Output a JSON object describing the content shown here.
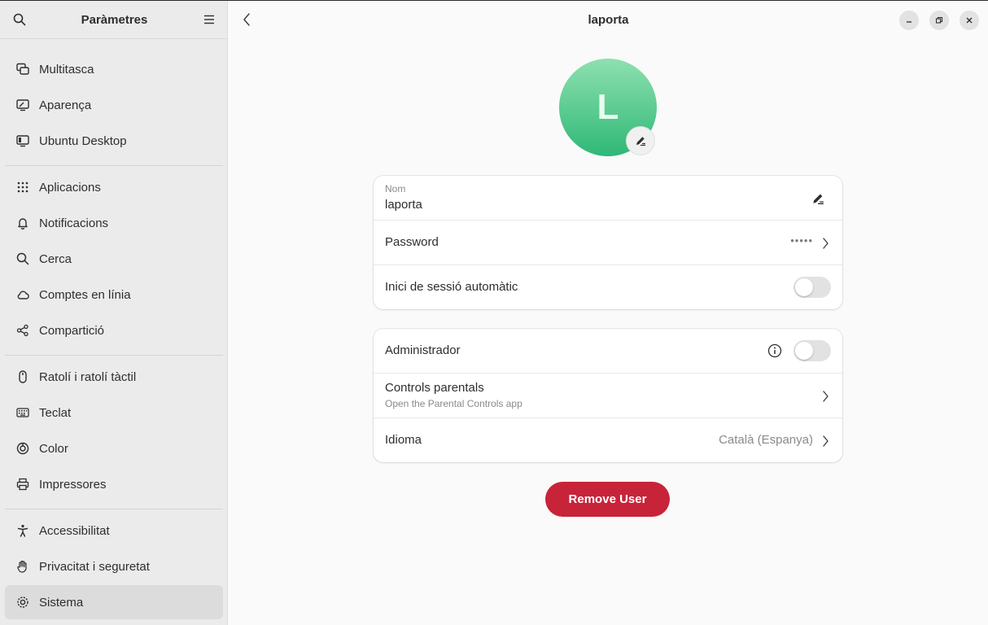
{
  "sidebar": {
    "title": "Paràmetres",
    "items": [
      {
        "label": "Multitasca",
        "icon": "multitasking-icon"
      },
      {
        "label": "Aparença",
        "icon": "appearance-icon"
      },
      {
        "label": "Ubuntu Desktop",
        "icon": "ubuntu-desktop-icon"
      },
      {
        "label": "Aplicacions",
        "icon": "apps-grid-icon"
      },
      {
        "label": "Notificacions",
        "icon": "bell-icon"
      },
      {
        "label": "Cerca",
        "icon": "search-icon"
      },
      {
        "label": "Comptes en línia",
        "icon": "cloud-icon"
      },
      {
        "label": "Compartició",
        "icon": "share-icon"
      },
      {
        "label": "Ratolí i ratolí tàctil",
        "icon": "mouse-icon"
      },
      {
        "label": "Teclat",
        "icon": "keyboard-icon"
      },
      {
        "label": "Color",
        "icon": "color-icon"
      },
      {
        "label": "Impressores",
        "icon": "printer-icon"
      },
      {
        "label": "Accessibilitat",
        "icon": "accessibility-icon"
      },
      {
        "label": "Privacitat i seguretat",
        "icon": "hand-icon"
      },
      {
        "label": "Sistema",
        "icon": "gear-icon",
        "active": true
      }
    ]
  },
  "header": {
    "title": "laporta"
  },
  "avatar": {
    "initial": "L",
    "colors": [
      "#8ee0af",
      "#2fb877"
    ]
  },
  "account": {
    "name_label": "Nom",
    "name_value": "laporta",
    "password_label": "Password",
    "password_value": "•••••",
    "autologin_label": "Inici de sessió automàtic",
    "autologin_on": false
  },
  "settings": {
    "admin_label": "Administrador",
    "admin_on": false,
    "parental_label": "Controls parentals",
    "parental_sub": "Open the Parental Controls app",
    "language_label": "Idioma",
    "language_value": "Català (Espanya)"
  },
  "remove_button": "Remove User",
  "accent_color": "#c7243a"
}
